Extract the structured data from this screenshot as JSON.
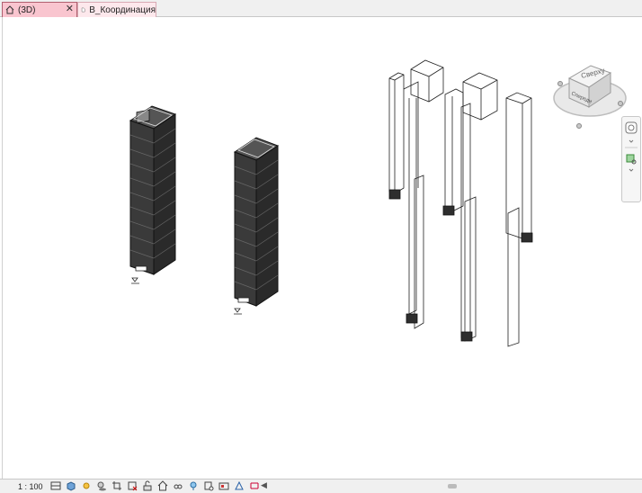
{
  "tabs": [
    {
      "label": "(3D)",
      "icon": "home-icon",
      "active": true
    },
    {
      "label": "В_Координация",
      "icon": "document-icon",
      "active": false
    }
  ],
  "tab_close": "✕",
  "viewcube": {
    "face_top": "Сверху",
    "face_front": "Спереди"
  },
  "status": {
    "scale": "1 : 100"
  },
  "colors": {
    "tab_active": "#f9c5cf",
    "tab_inactive": "#fde8ec",
    "model_dark": "#3a3a3a",
    "wire": "#222222"
  }
}
